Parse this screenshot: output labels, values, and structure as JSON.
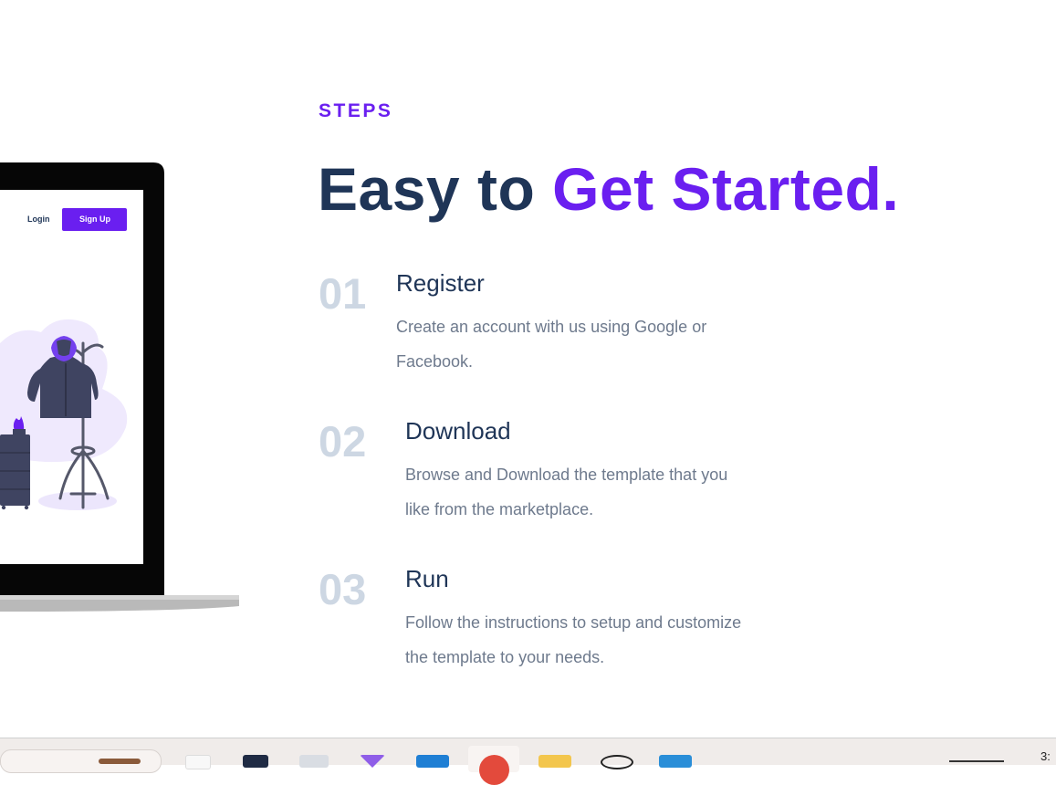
{
  "section": {
    "eyebrow": "STEPS",
    "headline_part1": "Easy to ",
    "headline_accent": "Get Started."
  },
  "steps": [
    {
      "number": "01",
      "title": "Register",
      "desc_line1": "Create an account with us using Google or",
      "desc_line2": "Facebook."
    },
    {
      "number": "02",
      "title": "Download",
      "desc_line1": "Browse and Download the template that you",
      "desc_line2": "like from the marketplace."
    },
    {
      "number": "03",
      "title": "Run",
      "desc_line1": "Follow the instructions to setup and customize",
      "desc_line2": "the template to your needs."
    }
  ],
  "laptop_preview": {
    "login_label": "Login",
    "signup_label": "Sign Up"
  },
  "taskbar": {
    "clock_partial": "3:"
  },
  "colors": {
    "accent": "#6a1ff0",
    "heading": "#1f3557",
    "muted_number": "#cdd7e3",
    "body_text": "#6e7a8d"
  }
}
